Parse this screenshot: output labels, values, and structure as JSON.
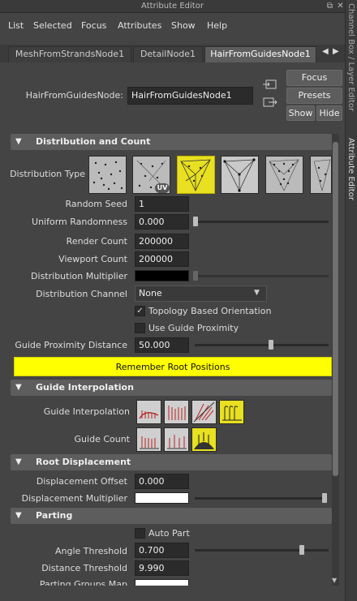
{
  "window": {
    "title": "Attribute Editor"
  },
  "side_panel": {
    "tab1": "Channel Box / Layer Editor",
    "tab2": "Attribute Editor"
  },
  "menu": [
    "List",
    "Selected",
    "Focus",
    "Attributes",
    "Show",
    "Help"
  ],
  "tabs": [
    "MeshFromStrandsNode1",
    "DetailNode1",
    "HairFromGuidesNode1"
  ],
  "node": {
    "label": "HairFromGuidesNode:",
    "value": "HairFromGuidesNode1"
  },
  "buttons": {
    "focus": "Focus",
    "presets": "Presets",
    "show": "Show",
    "hide": "Hide"
  },
  "distribution": {
    "section": "Distribution and Count",
    "type_label": "Distribution Type",
    "uv_badge": "UV",
    "random_seed_label": "Random Seed",
    "random_seed": "1",
    "uniform_randomness_label": "Uniform Randomness",
    "uniform_randomness": "0.000",
    "render_count_label": "Render Count",
    "render_count": "200000",
    "viewport_count_label": "Viewport Count",
    "viewport_count": "200000",
    "distribution_multiplier_label": "Distribution Multiplier",
    "distribution_channel_label": "Distribution Channel",
    "distribution_channel": "None",
    "topology_label": "Topology Based Orientation",
    "topology_checked": true,
    "guide_proximity_label": "Use Guide Proximity",
    "guide_proximity_checked": false,
    "guide_proximity_distance_label": "Guide Proximity Distance",
    "guide_proximity_distance": "50.000",
    "remember_button": "Remember Root Positions"
  },
  "guide_interp": {
    "section": "Guide Interpolation",
    "interp_label": "Guide Interpolation",
    "count_label": "Guide Count"
  },
  "root_disp": {
    "section": "Root Displacement",
    "offset_label": "Displacement Offset",
    "offset": "0.000",
    "multiplier_label": "Displacement Multiplier"
  },
  "parting": {
    "section": "Parting",
    "auto_part_label": "Auto Part",
    "auto_part_checked": false,
    "angle_label": "Angle Threshold",
    "angle": "0.700",
    "distance_label": "Distance Threshold",
    "distance": "9.990",
    "groups_map_label": "Parting Groups Map"
  },
  "colors": {
    "selected_thumb": "#e8e020",
    "highlight_button": "#ffff00"
  }
}
